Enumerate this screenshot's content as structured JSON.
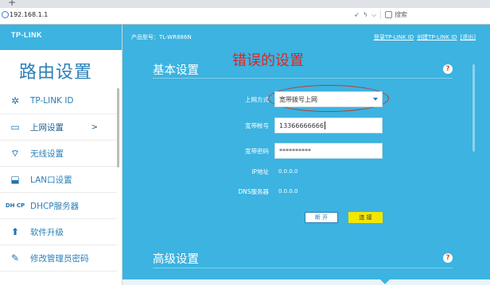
{
  "browser": {
    "tab_plus": "+",
    "url": "192.168.1.1",
    "search_placeholder": "搜索"
  },
  "brand": {
    "logo": "TP-LINK"
  },
  "sidebar": {
    "title": "路由设置",
    "items": [
      {
        "label": "TP-LINK ID",
        "icon": "gear-icon"
      },
      {
        "label": "上网设置",
        "icon": "monitor-icon",
        "arrow": ">"
      },
      {
        "label": "无线设置",
        "icon": "wifi-icon"
      },
      {
        "label": "LAN口设置",
        "icon": "lan-icon"
      },
      {
        "label": "DHCP服务器",
        "icon": "dhcp-icon",
        "icon_text": "DH CP"
      },
      {
        "label": "软件升级",
        "icon": "upload-icon"
      },
      {
        "label": "修改管理员密码",
        "icon": "pencil-icon"
      }
    ]
  },
  "header": {
    "model": "产品型号：TL-WR886N",
    "links": [
      "登录TP-LINK ID",
      "创建TP-LINK ID",
      "[退出]"
    ]
  },
  "basic": {
    "title": "基本设置",
    "annotation": "错误的设置",
    "fields": {
      "conn_type_label": "上网方式",
      "conn_type_value": "宽带拨号上网",
      "account_label": "宽带帐号",
      "account_value": "13366666666",
      "password_label": "宽带密码",
      "password_value": "**********",
      "ip_label": "IP地址",
      "ip_value": "0.0.0.0",
      "dns_label": "DNS服务器",
      "dns_value": "0.0.0.0"
    },
    "buttons": {
      "disconnect": "断 开",
      "connect": "连 接"
    }
  },
  "advanced": {
    "title": "高级设置"
  },
  "colors": {
    "accent": "#3cb3e0",
    "error": "#e0251f",
    "connect_button": "#f3e600"
  }
}
